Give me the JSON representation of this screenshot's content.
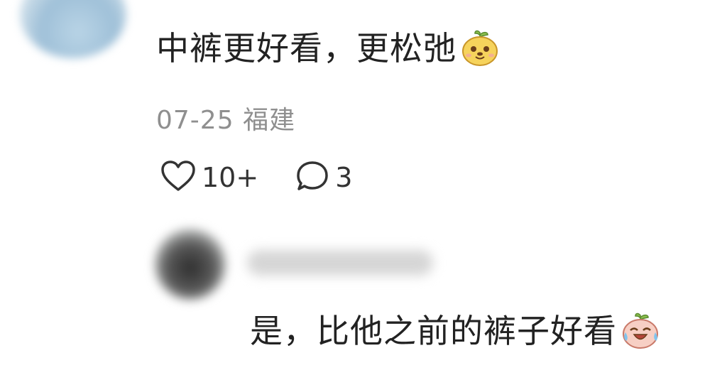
{
  "comment": {
    "text": "中裤更好看，更松弛",
    "emoji_icon": "smiling-pear-emoji-icon",
    "date": "07-25",
    "location": "福建",
    "like_count": "10+",
    "reply_count": "3"
  },
  "reply": {
    "text": "是，比他之前的裤子好看",
    "emoji_icon": "crying-laughing-pear-emoji-icon"
  },
  "colors": {
    "text": "#222222",
    "meta": "#8f8f8f",
    "icon": "#333333",
    "emoji_yellow": "#f6d35c",
    "emoji_pink": "#f2a7a0",
    "emoji_leaf": "#8cc04f"
  }
}
